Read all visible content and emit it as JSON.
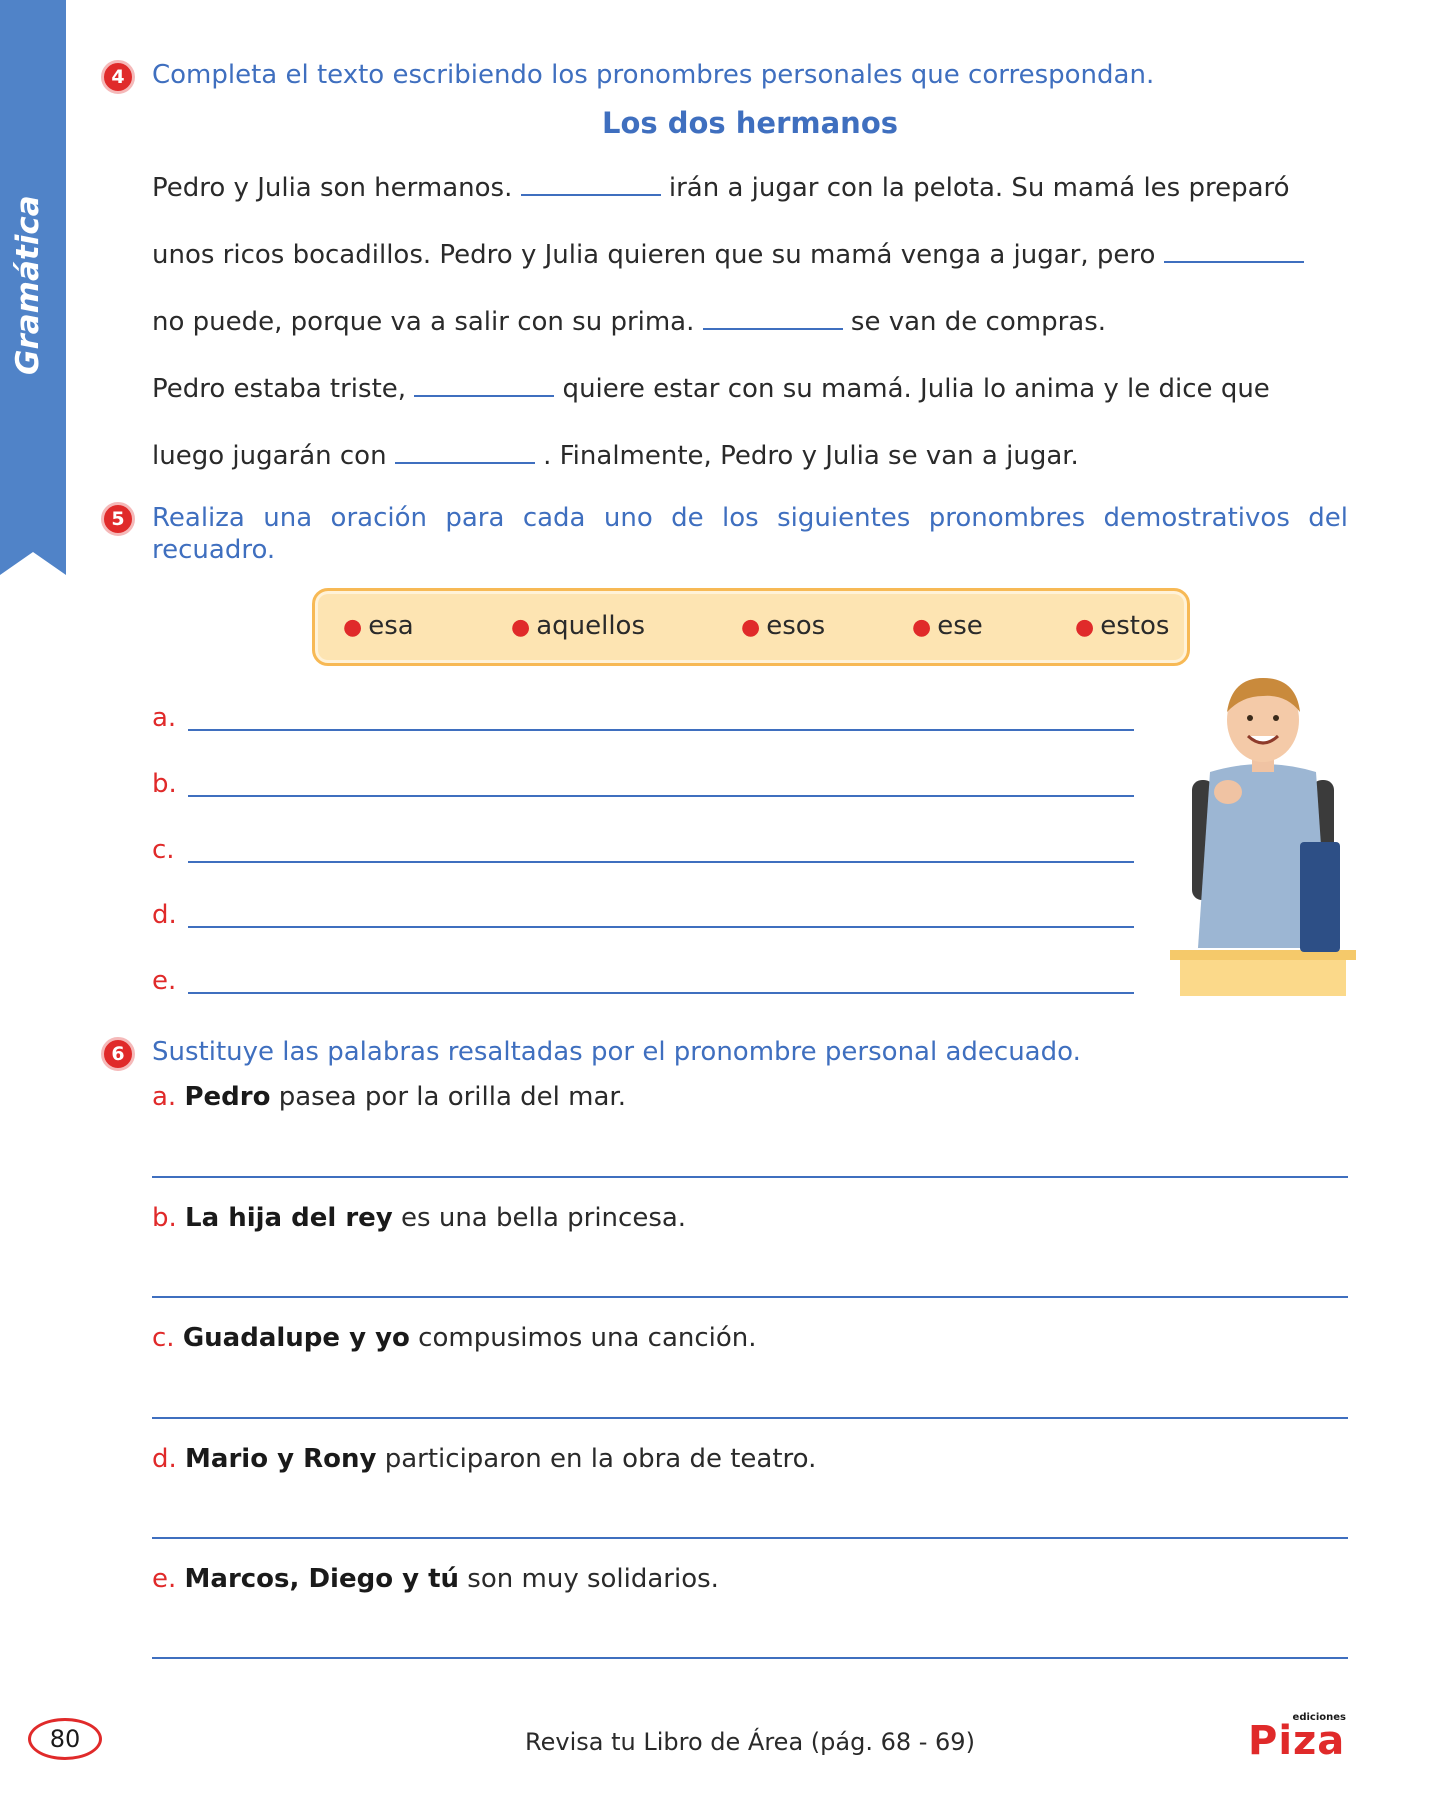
{
  "sidebar": {
    "label": "Gramática"
  },
  "exercise4": {
    "number": "4",
    "instruction": "Completa el texto escribiendo los pronombres personales que correspondan.",
    "title": "Los dos hermanos",
    "lines": [
      {
        "before": "Pedro y Julia son hermanos. ",
        "after": " irán a jugar con la pelota. Su mamá les preparó"
      },
      {
        "before": "unos ricos bocadillos. Pedro y Julia quieren que su mamá venga a jugar, pero ",
        "after": ""
      },
      {
        "before": "no puede, porque va a salir con su prima. ",
        "after": " se van de compras."
      },
      {
        "before": "Pedro estaba triste, ",
        "after": " quiere estar con su mamá. Julia lo anima y le dice que"
      },
      {
        "before": "luego jugarán con  ",
        "after": " . Finalmente, Pedro y Julia se van a jugar."
      }
    ]
  },
  "exercise5": {
    "number": "5",
    "instruction": "Realiza una oración para cada uno de los siguientes pronombres demostrativos del recuadro.",
    "words": [
      "esa",
      "aquellos",
      "esos",
      "ese",
      "estos"
    ],
    "letters": [
      "a.",
      "b.",
      "c.",
      "d.",
      "e."
    ]
  },
  "exercise6": {
    "number": "6",
    "instruction": "Sustituye las palabras resaltadas por el pronombre personal adecuado.",
    "items": [
      {
        "letter": "a.",
        "bold": "Pedro",
        "rest": " pasea por la orilla del mar."
      },
      {
        "letter": "b.",
        "bold": "La hija del rey",
        "rest": " es una bella princesa."
      },
      {
        "letter": "c.",
        "bold": "Guadalupe y yo",
        "rest": " compusimos una canción."
      },
      {
        "letter": "d.",
        "bold": "Mario y Rony",
        "rest": " participaron en la obra de teatro."
      },
      {
        "letter": "e.",
        "bold": "Marcos, Diego y tú",
        "rest": " son muy solidarios."
      }
    ]
  },
  "footer": {
    "page_number": "80",
    "reference": "Revisa tu Libro de Área (pág. 68 - 69)",
    "logo_small": "ediciones",
    "logo_main": "Piza"
  },
  "colors": {
    "accent_blue": "#3f6fbf",
    "accent_red": "#e02a2a",
    "box_fill": "#fde4b2"
  }
}
